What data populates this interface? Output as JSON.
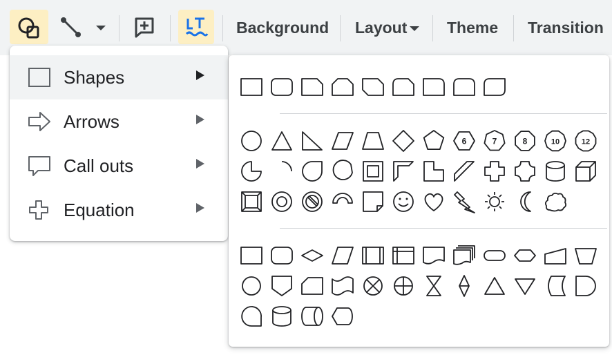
{
  "toolbar": {
    "background_label": "Background",
    "layout_label": "Layout",
    "theme_label": "Theme",
    "transition_label": "Transition",
    "icons": [
      "shapes-icon",
      "line-icon",
      "dropdown-caret-icon",
      "comment-icon",
      "text-format-icon"
    ]
  },
  "menu": {
    "items": [
      {
        "label": "Shapes",
        "icon": "square-outline-icon",
        "highlighted": true
      },
      {
        "label": "Arrows",
        "icon": "arrow-outline-icon",
        "highlighted": false
      },
      {
        "label": "Call outs",
        "icon": "callout-outline-icon",
        "highlighted": false
      },
      {
        "label": "Equation",
        "icon": "plus-outline-icon",
        "highlighted": false
      }
    ]
  },
  "palette": {
    "section_1": [
      "rectangle",
      "rounded-rectangle",
      "snip-single-corner",
      "snip-same-side",
      "snip-diagonal",
      "snip-round-single",
      "round-single-corner",
      "round-same-side",
      "round-diagonal"
    ],
    "section_2": {
      "row_1": [
        "ellipse",
        "triangle",
        "right-triangle",
        "parallelogram",
        "trapezoid",
        "diamond",
        "pentagon",
        "hexagon-6",
        "heptagon-7",
        "octagon-8",
        "decagon-10",
        "dodecagon-12"
      ],
      "badges": {
        "hexagon-6": "6",
        "heptagon-7": "7",
        "octagon-8": "8",
        "decagon-10": "10",
        "dodecagon-12": "12"
      },
      "row_2": [
        "pie",
        "arc",
        "teardrop",
        "chord",
        "frame",
        "half-frame",
        "l-shape",
        "diagonal-stripe",
        "cross",
        "plaque",
        "can",
        "cube"
      ],
      "row_3": [
        "bevel",
        "donut",
        "no-symbol",
        "block-arc",
        "folded-corner",
        "smiley-face",
        "heart",
        "lightning-bolt",
        "sun",
        "moon",
        "cloud"
      ]
    },
    "section_3": {
      "row_1": [
        "flowchart-process",
        "flowchart-alternate-process",
        "flowchart-decision",
        "flowchart-data",
        "flowchart-predefined-process",
        "flowchart-internal-storage",
        "flowchart-document",
        "flowchart-multidocument",
        "flowchart-terminator",
        "flowchart-preparation",
        "flowchart-manual-input",
        "flowchart-manual-operation"
      ],
      "row_2": [
        "flowchart-connector",
        "flowchart-offpage-connector",
        "flowchart-card",
        "flowchart-punched-tape",
        "flowchart-summing-junction",
        "flowchart-or",
        "flowchart-collate",
        "flowchart-sort",
        "flowchart-extract",
        "flowchart-merge",
        "flowchart-stored-data",
        "flowchart-delay"
      ],
      "row_3": [
        "flowchart-sequential-access-storage",
        "flowchart-magnetic-disk",
        "flowchart-direct-access-storage",
        "flowchart-display"
      ]
    }
  },
  "colors": {
    "toolbar_bg": "#f1f3f4",
    "active_button_bg": "#fdefc3",
    "accent_blue": "#1a73e8",
    "text": "#202124"
  }
}
